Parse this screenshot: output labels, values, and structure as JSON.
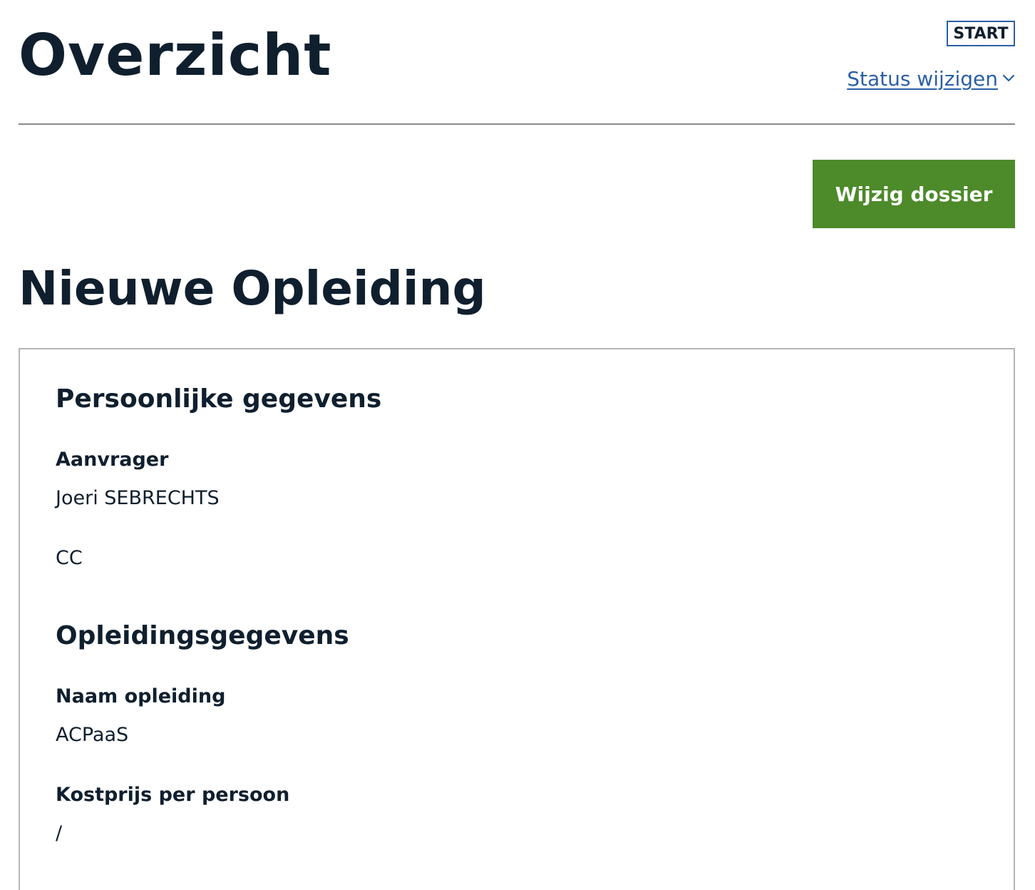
{
  "header": {
    "title": "Overzicht",
    "status_badge": "START",
    "status_link": "Status wijzigen",
    "chevron_icon": "chevron-down-icon"
  },
  "actions": {
    "edit_dossier": "Wijzig dossier"
  },
  "dossier": {
    "title": "Nieuwe Opleiding"
  },
  "personal": {
    "heading": "Persoonlijke gegevens",
    "requester_label": "Aanvrager",
    "requester_value": "Joeri SEBRECHTS",
    "cc_value": "CC"
  },
  "training": {
    "heading": "Opleidingsgegevens",
    "name_label": "Naam opleiding",
    "name_value": "ACPaaS",
    "cost_label": "Kostprijs per persoon",
    "cost_value": "/"
  },
  "colors": {
    "text": "#0f1f2e",
    "link": "#2b5fa6",
    "button": "#4c8a2a",
    "divider": "#8a8a8a",
    "panel_border": "#b5b5b5"
  }
}
